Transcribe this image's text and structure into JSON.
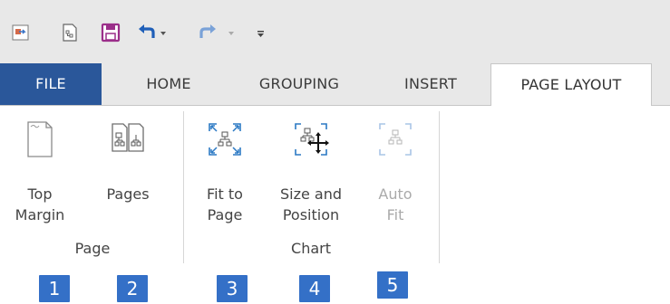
{
  "quick_access": {
    "icons": [
      "app-icon",
      "new-document-icon",
      "save-icon",
      "undo-icon",
      "redo-icon",
      "customize-icon"
    ]
  },
  "tabs": [
    {
      "label": "FILE"
    },
    {
      "label": "HOME"
    },
    {
      "label": "GROUPING"
    },
    {
      "label": "INSERT"
    },
    {
      "label": "PAGE LAYOUT"
    }
  ],
  "ribbon": {
    "groups": [
      {
        "label": "Page",
        "buttons": [
          {
            "label": "Top\nMargin",
            "icon": "top-margin-icon",
            "enabled": true
          },
          {
            "label": "Pages",
            "icon": "pages-icon",
            "enabled": true
          }
        ]
      },
      {
        "label": "Chart",
        "buttons": [
          {
            "label": "Fit to\nPage",
            "icon": "fit-to-page-icon",
            "enabled": true
          },
          {
            "label": "Size and\nPosition",
            "icon": "size-and-position-icon",
            "enabled": true
          },
          {
            "label": "Auto\nFit",
            "icon": "auto-fit-icon",
            "enabled": false
          }
        ]
      }
    ]
  },
  "badges": [
    "1",
    "2",
    "3",
    "4",
    "5"
  ],
  "colors": {
    "file_tab": "#2a579a",
    "badge": "#3470c7",
    "toolbar_bg": "#e8e8e8"
  }
}
